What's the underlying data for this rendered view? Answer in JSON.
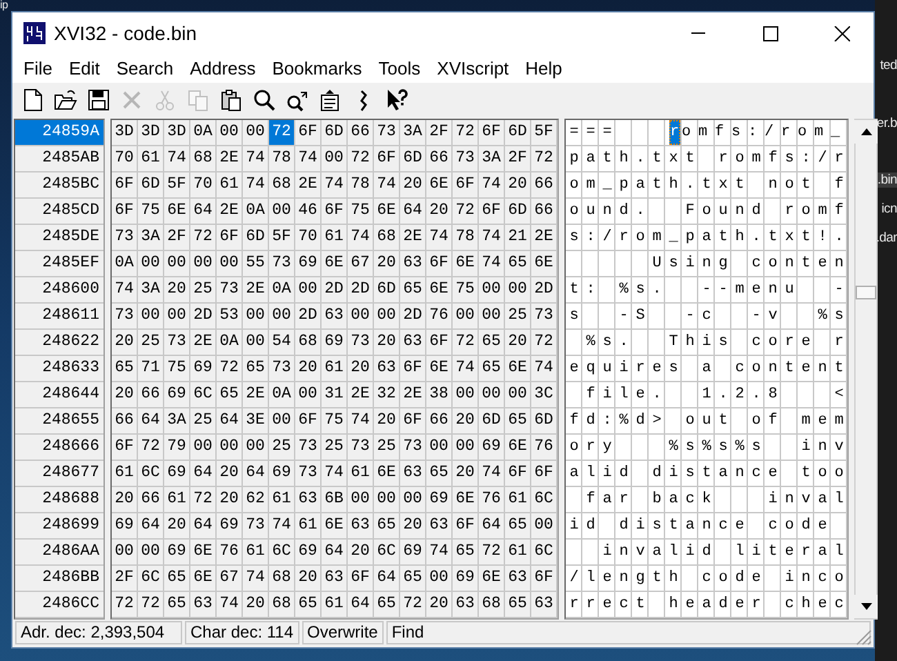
{
  "desktop": {
    "fragments": [
      {
        "text": "ip",
        "kind": "plain"
      },
      {
        "text": "ted",
        "kind": "plain"
      },
      {
        "text": "er.b",
        "kind": "plain"
      },
      {
        "text": ".bin",
        "kind": "highlight"
      },
      {
        "text": "icn",
        "kind": "plain"
      },
      {
        "text": ".dar",
        "kind": "plain"
      }
    ]
  },
  "window": {
    "title": "XVI32 - code.bin"
  },
  "menu": [
    "File",
    "Edit",
    "Search",
    "Address",
    "Bookmarks",
    "Tools",
    "XVIscript",
    "Help"
  ],
  "toolbar": [
    {
      "kind": "new",
      "disabled": false
    },
    {
      "kind": "open",
      "disabled": false
    },
    {
      "kind": "save",
      "disabled": false
    },
    {
      "kind": "delete",
      "disabled": true
    },
    {
      "kind": "cut",
      "disabled": true
    },
    {
      "kind": "copy",
      "disabled": true
    },
    {
      "kind": "paste",
      "disabled": false
    },
    {
      "kind": "find",
      "disabled": false
    },
    {
      "kind": "replace",
      "disabled": false
    },
    {
      "kind": "properties",
      "disabled": false
    },
    {
      "kind": "link",
      "disabled": false
    },
    {
      "kind": "help",
      "disabled": false
    }
  ],
  "editor": {
    "rows": [
      {
        "address": "24859A",
        "selected": true,
        "kind": "cursor",
        "hex_before": "3D 3D 3D 0A 00 00",
        "hex_cursor": "72",
        "hex_after": "6F 6D 66 73 3A 2F 72 6F 6D 5F",
        "chars_before": "===   ",
        "char_cursor": "r",
        "chars_after": "omfs:/rom_"
      },
      {
        "address": "2485AB",
        "selected": false,
        "kind": "plain",
        "hex": "70 61 74 68 2E 74 78 74 00 72 6F 6D 66 73 3A 2F 72",
        "chars": "path.txt romfs:/r"
      },
      {
        "address": "2485BC",
        "selected": false,
        "kind": "plain",
        "hex": "6F 6D 5F 70 61 74 68 2E 74 78 74 20 6E 6F 74 20 66",
        "chars": "om_path.txt not f"
      },
      {
        "address": "2485CD",
        "selected": false,
        "kind": "plain",
        "hex": "6F 75 6E 64 2E 0A 00 46 6F 75 6E 64 20 72 6F 6D 66",
        "chars": "ound.  Found romf"
      },
      {
        "address": "2485DE",
        "selected": false,
        "kind": "plain",
        "hex": "73 3A 2F 72 6F 6D 5F 70 61 74 68 2E 74 78 74 21 2E",
        "chars": "s:/rom_path.txt!."
      },
      {
        "address": "2485EF",
        "selected": false,
        "kind": "plain",
        "hex": "0A 00 00 00 00 55 73 69 6E 67 20 63 6F 6E 74 65 6E",
        "chars": "     Using conten"
      },
      {
        "address": "248600",
        "selected": false,
        "kind": "plain",
        "hex": "74 3A 20 25 73 2E 0A 00 2D 2D 6D 65 6E 75 00 00 2D",
        "chars": "t: %s.  --menu  -"
      },
      {
        "address": "248611",
        "selected": false,
        "kind": "plain",
        "hex": "73 00 00 2D 53 00 00 2D 63 00 00 2D 76 00 00 25 73",
        "chars": "s  -S  -c  -v  %s"
      },
      {
        "address": "248622",
        "selected": false,
        "kind": "plain",
        "hex": "20 25 73 2E 0A 00 54 68 69 73 20 63 6F 72 65 20 72",
        "chars": " %s.  This core r"
      },
      {
        "address": "248633",
        "selected": false,
        "kind": "plain",
        "hex": "65 71 75 69 72 65 73 20 61 20 63 6F 6E 74 65 6E 74",
        "chars": "equires a content"
      },
      {
        "address": "248644",
        "selected": false,
        "kind": "plain",
        "hex": "20 66 69 6C 65 2E 0A 00 31 2E 32 2E 38 00 00 00 3C",
        "chars": " file.  1.2.8   <"
      },
      {
        "address": "248655",
        "selected": false,
        "kind": "plain",
        "hex": "66 64 3A 25 64 3E 00 6F 75 74 20 6F 66 20 6D 65 6D",
        "chars": "fd:%d> out of mem"
      },
      {
        "address": "248666",
        "selected": false,
        "kind": "plain",
        "hex": "6F 72 79 00 00 00 25 73 25 73 25 73 00 00 69 6E 76",
        "chars": "ory   %s%s%s  inv"
      },
      {
        "address": "248677",
        "selected": false,
        "kind": "plain",
        "hex": "61 6C 69 64 20 64 69 73 74 61 6E 63 65 20 74 6F 6F",
        "chars": "alid distance too"
      },
      {
        "address": "248688",
        "selected": false,
        "kind": "plain",
        "hex": "20 66 61 72 20 62 61 63 6B 00 00 00 69 6E 76 61 6C",
        "chars": " far back   inval"
      },
      {
        "address": "248699",
        "selected": false,
        "kind": "plain",
        "hex": "69 64 20 64 69 73 74 61 6E 63 65 20 63 6F 64 65 00",
        "chars": "id distance code "
      },
      {
        "address": "2486AA",
        "selected": false,
        "kind": "plain",
        "hex": "00 00 69 6E 76 61 6C 69 64 20 6C 69 74 65 72 61 6C",
        "chars": "  invalid literal"
      },
      {
        "address": "2486BB",
        "selected": false,
        "kind": "plain",
        "hex": "2F 6C 65 6E 67 74 68 20 63 6F 64 65 00 69 6E 63 6F",
        "chars": "/length code inco"
      },
      {
        "address": "2486CC",
        "selected": false,
        "kind": "plain",
        "hex": "72 72 65 63 74 20 68 65 61 64 65 72 20 63 68 65 63",
        "chars": "rrect header chec"
      }
    ]
  },
  "status_bar": [
    "Adr. dec: 2,393,504",
    "Char dec: 114",
    "Overwrite",
    "Find"
  ]
}
